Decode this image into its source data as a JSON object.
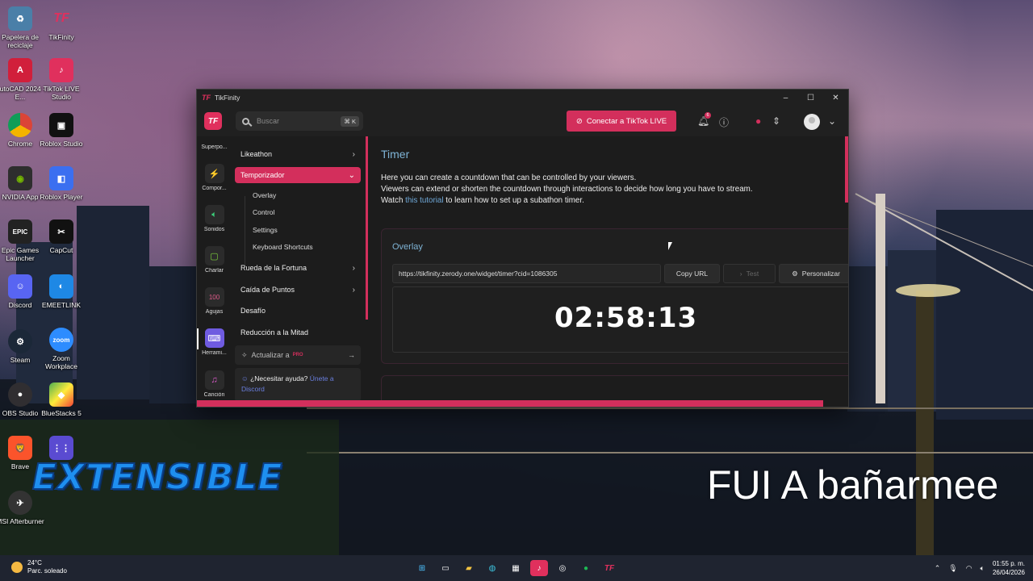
{
  "desktop": {
    "icons": [
      {
        "label": "Papelera de reciclaje"
      },
      {
        "label": "TikFinity"
      },
      {
        "label": "AutoCAD 2024 - E..."
      },
      {
        "label": "TikTok LIVE Studio"
      },
      {
        "label": "Chrome"
      },
      {
        "label": "Roblox Studio"
      },
      {
        "label": "NVIDIA App"
      },
      {
        "label": "Roblox Player"
      },
      {
        "label": "Epic Games Launcher"
      },
      {
        "label": "CapCut"
      },
      {
        "label": "Discord"
      },
      {
        "label": "EMEETLINK"
      },
      {
        "label": "Steam"
      },
      {
        "label": "Zoom Workplace"
      },
      {
        "label": "OBS Studio"
      },
      {
        "label": "BlueStacks 5"
      },
      {
        "label": "Brave"
      },
      {
        "label": "MSI Afterburner"
      }
    ],
    "overlay_logo": "EXTENSIBLE",
    "caption": "FUI A bañarmee"
  },
  "window": {
    "title": "TikFinity",
    "title_logo": "TF",
    "controls": {
      "minimize": "–",
      "maximize": "☐",
      "close": "✕"
    }
  },
  "topbar": {
    "search_placeholder": "Buscar",
    "search_shortcut": "⌘ K",
    "connect_label": "Conectar a TikTok LIVE",
    "notification_count": "6"
  },
  "rail": {
    "items": [
      {
        "label": "Superpo..."
      },
      {
        "label": "Compor..."
      },
      {
        "label": "Sonidos"
      },
      {
        "label": "Charlar"
      },
      {
        "label": "Agujas"
      },
      {
        "label": "Herrami..."
      },
      {
        "label": "Canción"
      }
    ]
  },
  "submenu": {
    "items": [
      {
        "label": "Likeathon"
      },
      {
        "label": "Temporizador"
      },
      {
        "label": "Rueda de la Fortuna"
      },
      {
        "label": "Caída de Puntos"
      },
      {
        "label": "Desafío"
      },
      {
        "label": "Reducción a la Mitad"
      }
    ],
    "sub_items": [
      {
        "label": "Overlay"
      },
      {
        "label": "Control"
      },
      {
        "label": "Settings"
      },
      {
        "label": "Keyboard Shortcuts"
      }
    ],
    "upgrade_label": "Actualizar a",
    "upgrade_badge": "PRO",
    "help_text": "¿Necesitar ayuda?",
    "help_link_1": "Únete a",
    "help_link_2": "Discord"
  },
  "main": {
    "title": "Timer",
    "desc_line1": "Here you can create a countdown that can be controlled by your viewers.",
    "desc_line2": "Viewers can extend or shorten the countdown through interactions to decide how long you have to stream.",
    "desc_line3_pre": "Watch",
    "desc_link": "this tutorial",
    "desc_line3_post": "to learn how to set up a subathon timer.",
    "overlay_card": {
      "title": "Overlay",
      "url": "https://tikfinity.zerody.one/widget/timer?cid=1086305",
      "copy_label": "Copy URL",
      "test_label": "Test",
      "customize_label": "Personalizar",
      "timer_value": "02:58:13"
    }
  },
  "taskbar": {
    "temperature": "24°C",
    "weather": "Parc. soleado",
    "time": "01:55 p. m.",
    "date": "26/04/2026"
  }
}
